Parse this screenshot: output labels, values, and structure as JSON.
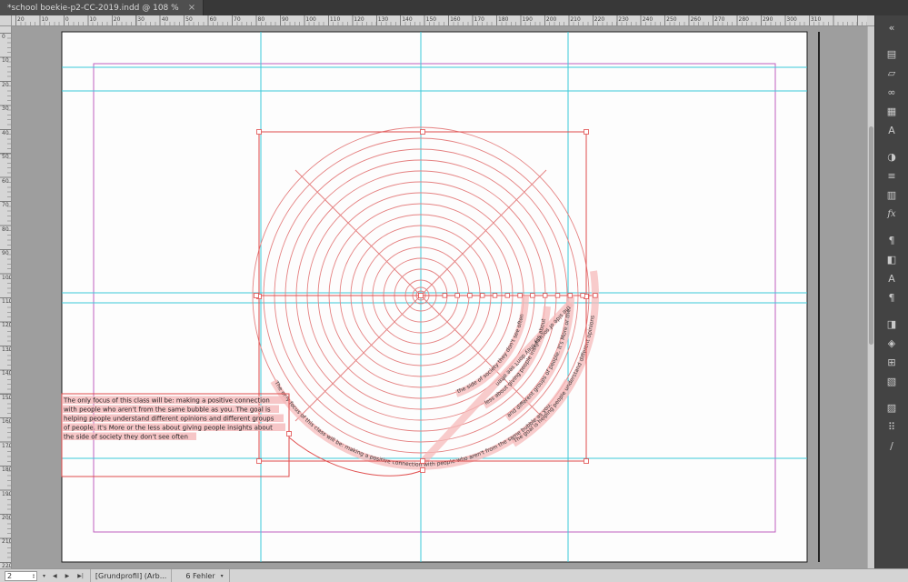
{
  "window": {
    "tab_title": "*school boekie-p2-CC-2019.indd @ 108 %",
    "close_glyph": "×"
  },
  "rulers": {
    "h_numbers": [
      "20",
      "10",
      "0",
      "10",
      "20",
      "30",
      "40",
      "50",
      "60",
      "70",
      "80",
      "90",
      "100",
      "110",
      "120",
      "130",
      "140",
      "150",
      "160",
      "170",
      "180",
      "190",
      "200",
      "210",
      "220",
      "230",
      "240",
      "250",
      "260",
      "270",
      "280",
      "290",
      "300",
      "310"
    ],
    "v_numbers": [
      "0",
      "10",
      "20",
      "30",
      "40",
      "50",
      "60",
      "70",
      "80",
      "90",
      "100",
      "110",
      "120",
      "130",
      "140",
      "150",
      "160",
      "170",
      "180",
      "190",
      "200",
      "210",
      "220"
    ]
  },
  "artwork": {
    "paragraph_lines": [
      "The only focus of this class will be: making a positive connection",
      "with people who aren't from the same bubble as you. The goal is",
      "helping people understand different opinions and different groups",
      "of people. It's More or the less about giving people insights about",
      "the side of society they don't see often"
    ],
    "arc_a": "The only focus of this class will be: making a positive connection with people who aren't from the same bubble as you.",
    "arc_b": "The goal is helping people understand different opinions",
    "arc_c": "and different groups of people. It's More or the",
    "arc_d": "less about giving people insights about",
    "arc_e": "the side of society they don't see often",
    "diag": "the side of society they don't see often"
  },
  "panel": {
    "icons": [
      {
        "name": "collapse-panels-icon",
        "glyph": "«"
      },
      {
        "name": "pages-icon",
        "glyph": "▤",
        "gap": true
      },
      {
        "name": "layers-icon",
        "glyph": "▱"
      },
      {
        "name": "links-icon",
        "glyph": "∞"
      },
      {
        "name": "swatches-icon",
        "glyph": "▦"
      },
      {
        "name": "glyphs-icon",
        "glyph": "A"
      },
      {
        "name": "color-icon",
        "glyph": "◑",
        "gap": true
      },
      {
        "name": "stroke-icon",
        "glyph": "≡"
      },
      {
        "name": "gradient-icon",
        "glyph": "▥"
      },
      {
        "name": "effects-icon",
        "glyph": "fx"
      },
      {
        "name": "paragraph-icon",
        "glyph": "¶",
        "gap": true
      },
      {
        "name": "text-wrap-icon",
        "glyph": "◧"
      },
      {
        "name": "character-styles-icon",
        "glyph": "A"
      },
      {
        "name": "paragraph-styles-icon",
        "glyph": "¶"
      },
      {
        "name": "object-styles-icon",
        "glyph": "◨",
        "gap": true
      },
      {
        "name": "pathfinder-icon",
        "glyph": "◈"
      },
      {
        "name": "table-icon",
        "glyph": "⊞"
      },
      {
        "name": "cell-styles-icon",
        "glyph": "▧"
      },
      {
        "name": "table-styles-icon",
        "glyph": "▨",
        "gap": true
      },
      {
        "name": "align-icon",
        "glyph": "⠿"
      },
      {
        "name": "pen-icon",
        "glyph": "∕"
      }
    ]
  },
  "status": {
    "page_value": "2",
    "spinner_up": "▴",
    "spinner_down": "▾",
    "dropdown_glyph": "▾",
    "nav_prev": "◀",
    "nav_next": "▶",
    "nav_last": "▶|",
    "profile_label": "[Grundprofil] (Arb...",
    "error_label": "6 Fehler"
  },
  "colors": {
    "guide_cyan": "#3cc9d9",
    "margin_magenta": "#c05fc0",
    "artwork_red": "#e04b4b",
    "circle_red": "#e58282",
    "highlight_pink": "#f5b9ba",
    "error_red": "#e0574b"
  }
}
